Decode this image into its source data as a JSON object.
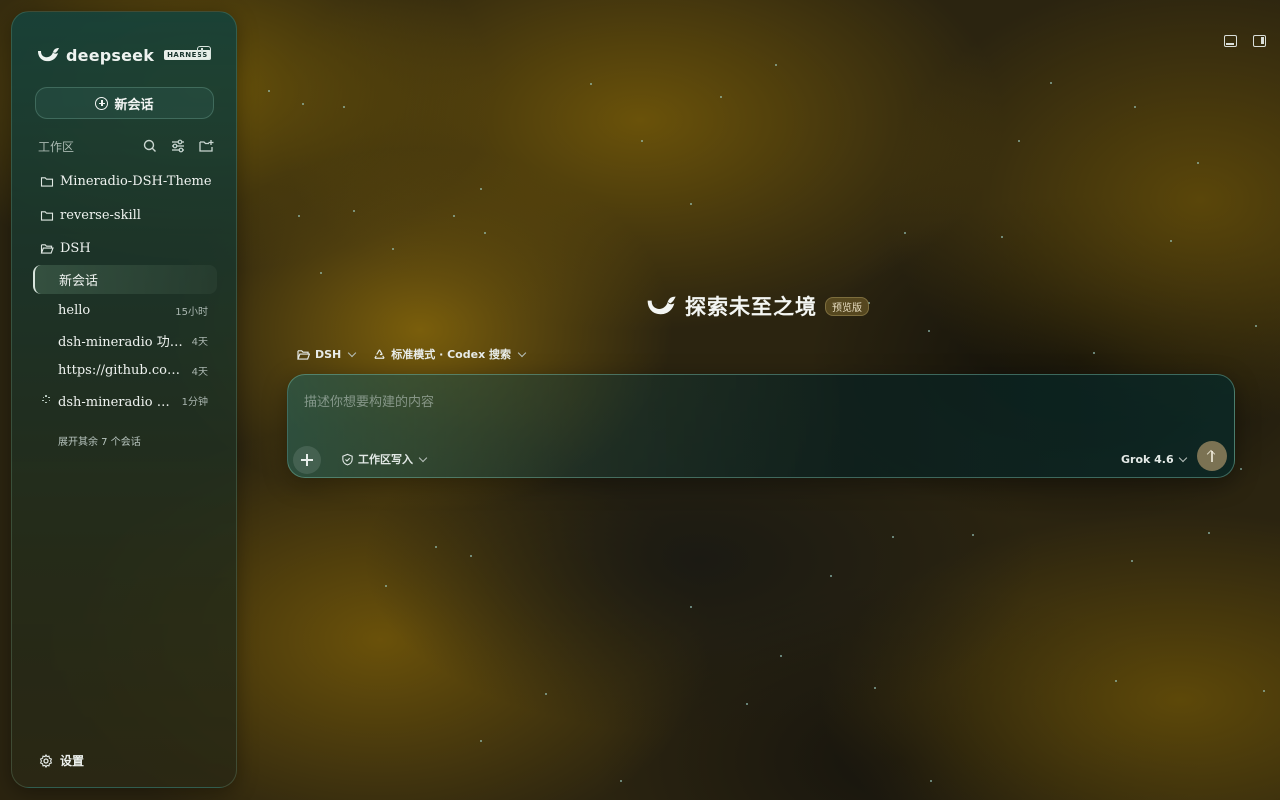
{
  "app": {
    "brand_name": "deepseek",
    "brand_tag": "HARNESS",
    "brand_color": "#eef3f0",
    "accent_color": "#2a6b5c"
  },
  "sidebar": {
    "new_chat_label": "新会话",
    "workspace_label": "工作区",
    "folders": [
      {
        "name": "Mineradio-DSH-Theme",
        "icon": "folder-icon"
      },
      {
        "name": "reverse-skill",
        "icon": "folder-icon"
      },
      {
        "name": "DSH",
        "icon": "folder-open-icon"
      }
    ],
    "sessions": [
      {
        "title": "新会话",
        "time": "",
        "active": true
      },
      {
        "title": "hello",
        "time": "15小时"
      },
      {
        "title": "dsh-mineradio 功…",
        "time": "4天"
      },
      {
        "title": "https://github.com…",
        "time": "4天"
      },
      {
        "title": "dsh-mineradio 功…",
        "time": "1分钟",
        "loading": true
      }
    ],
    "expand_more_label": "展开其余 7 个会话",
    "settings_label": "设置"
  },
  "main": {
    "hero_title": "探索未至之境",
    "hero_badge": "预览版",
    "workspace_selector": "DSH",
    "mode_selector": "标准模式 · Codex 搜索",
    "composer": {
      "placeholder": "描述你想要构建的内容",
      "value": "",
      "permission_label": "工作区写入",
      "model_label": "Grok 4.6"
    }
  }
}
